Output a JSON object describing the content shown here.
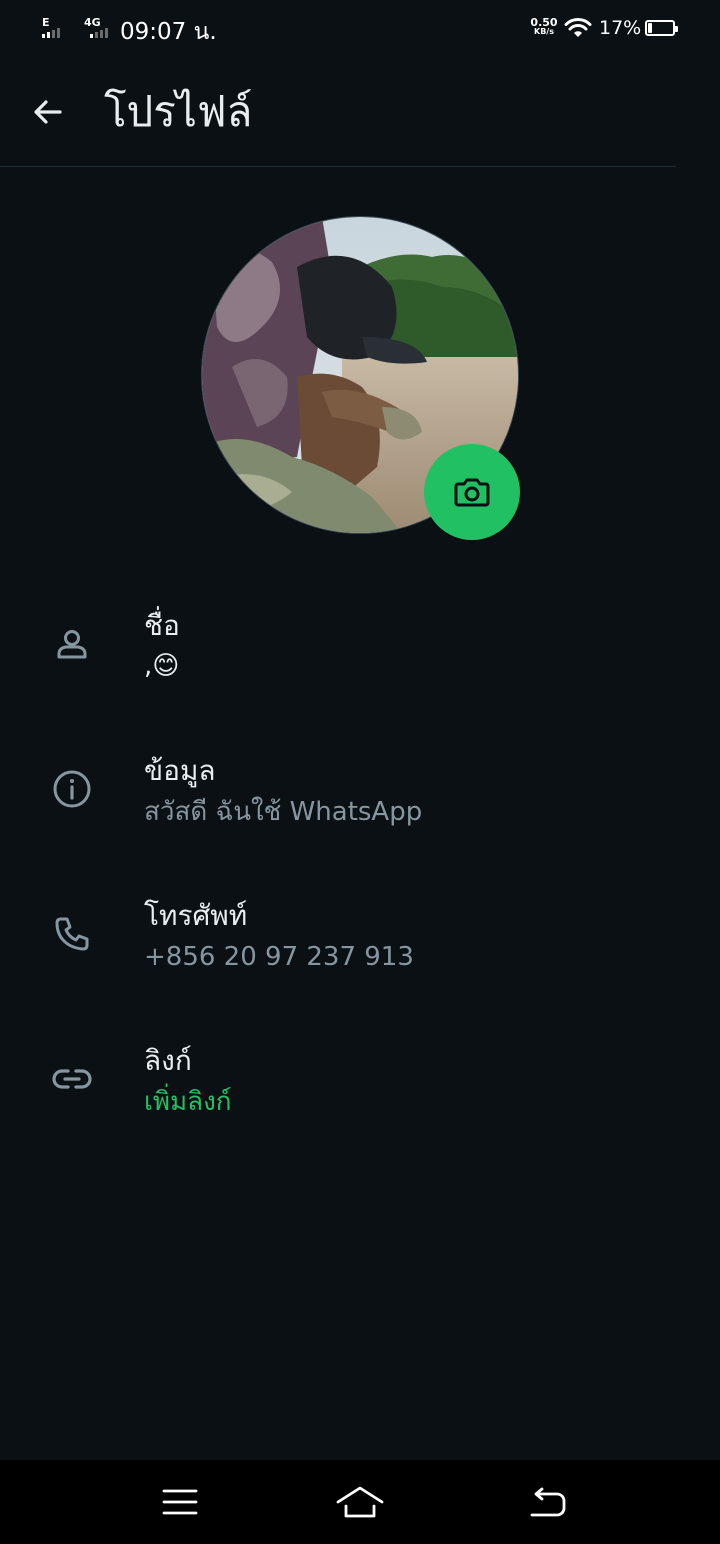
{
  "status_bar": {
    "sim1_type": "E",
    "sim2_type": "4G",
    "time": "09:07 น.",
    "speed_value": "0.50",
    "speed_unit": "KB/s",
    "battery_percent": "17%",
    "battery_level": 0.17
  },
  "header": {
    "back_icon": "arrow-left-icon",
    "title": "โปรไฟล์"
  },
  "avatar": {
    "camera_icon": "camera-icon"
  },
  "rows": [
    {
      "icon": "person-icon",
      "label": "ชื่อ",
      "value": ",😊",
      "value_style": "text"
    },
    {
      "icon": "info-icon",
      "label": "ข้อมูล",
      "value": "สวัสดี ฉันใช้ WhatsApp",
      "value_style": "muted"
    },
    {
      "icon": "phone-icon",
      "label": "โทรศัพท์",
      "value": "+856 20 97 237 913",
      "value_style": "muted"
    },
    {
      "icon": "link-icon",
      "label": "ลิงก์",
      "value": "เพิ่มลิงก์",
      "value_style": "link"
    }
  ],
  "nav_bar": {
    "items": [
      "menu-icon",
      "home-icon",
      "back-icon"
    ]
  },
  "colors": {
    "background": "#0b1014",
    "accent": "#21c063",
    "muted": "#8696a0",
    "text": "#e9edef"
  }
}
